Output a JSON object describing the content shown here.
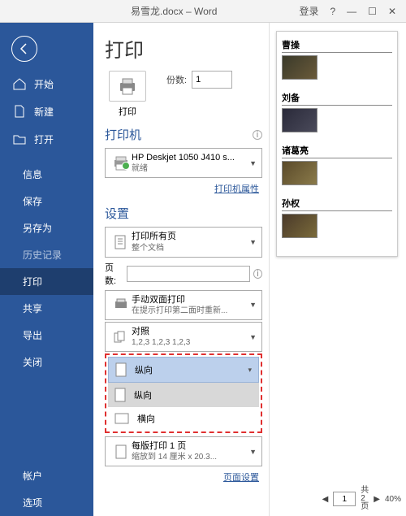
{
  "titlebar": {
    "filename": "易雪龙.docx",
    "app": "Word",
    "login": "登录"
  },
  "sidebar": {
    "home": "开始",
    "new": "新建",
    "open": "打开",
    "info": "信息",
    "save": "保存",
    "saveas": "另存为",
    "history": "历史记录",
    "print": "打印",
    "share": "共享",
    "export": "导出",
    "close": "关闭",
    "account": "帐户",
    "options": "选项"
  },
  "panel": {
    "title": "打印",
    "print_label": "打印",
    "copies_label": "份数:",
    "copies_value": "1",
    "printer_section": "打印机",
    "printer_name": "HP Deskjet 1050 J410 s...",
    "printer_status": "就绪",
    "printer_props": "打印机属性",
    "settings_section": "设置",
    "print_all": "打印所有页",
    "print_all_sub": "整个文档",
    "pages_label": "页数:",
    "duplex": "手动双面打印",
    "duplex_sub": "在提示打印第二面时重新...",
    "collate": "对照",
    "collate_sub": "1,2,3   1,2,3   1,2,3",
    "orient_portrait": "纵向",
    "orient_landscape": "横向",
    "per_page": "每版打印 1 页",
    "per_page_sub": "缩放到 14 厘米 x 20.3...",
    "page_setup": "页面设置"
  },
  "preview": {
    "h1": "曹操",
    "h2": "刘备",
    "h3": "诸葛亮",
    "h4": "孙权"
  },
  "footer": {
    "page_cur": "1",
    "page_label": "共2页",
    "zoom": "40%"
  }
}
